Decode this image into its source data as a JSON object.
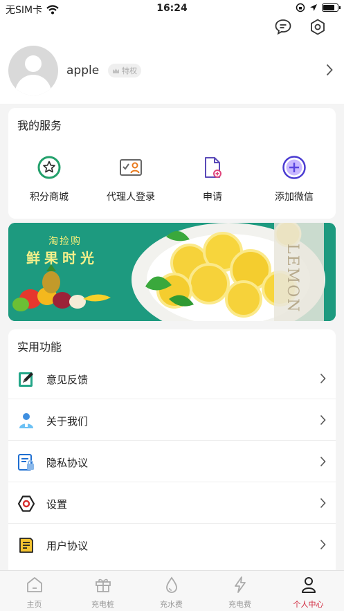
{
  "status": {
    "carrier": "无SIM卡",
    "time": "16:24"
  },
  "profile": {
    "username": "apple",
    "badge": "特权"
  },
  "services": {
    "title": "我的服务",
    "items": [
      {
        "label": "积分商城",
        "icon": "star-circle-icon"
      },
      {
        "label": "代理人登录",
        "icon": "agent-card-icon"
      },
      {
        "label": "申请",
        "icon": "document-add-icon"
      },
      {
        "label": "添加微信",
        "icon": "plus-circle-icon"
      }
    ]
  },
  "banner": {
    "tagline": "淘捡购",
    "headline": "鲜果时光",
    "side_text": "LEMON"
  },
  "functions": {
    "title": "实用功能",
    "items": [
      {
        "label": "意见反馈",
        "icon": "edit-icon"
      },
      {
        "label": "关于我们",
        "icon": "person-icon"
      },
      {
        "label": "隐私协议",
        "icon": "privacy-lock-icon"
      },
      {
        "label": "设置",
        "icon": "gear-icon"
      },
      {
        "label": "用户协议",
        "icon": "agreement-doc-icon"
      }
    ]
  },
  "tabs": [
    {
      "label": "主页",
      "icon": "home-icon"
    },
    {
      "label": "充电桩",
      "icon": "gift-box-icon"
    },
    {
      "label": "充水费",
      "icon": "water-drop-icon"
    },
    {
      "label": "充电费",
      "icon": "lightning-icon"
    },
    {
      "label": "个人中心",
      "icon": "user-icon",
      "active": true
    }
  ],
  "colors": {
    "accent": "#d0243a",
    "banner_green": "#1d9a7f"
  }
}
